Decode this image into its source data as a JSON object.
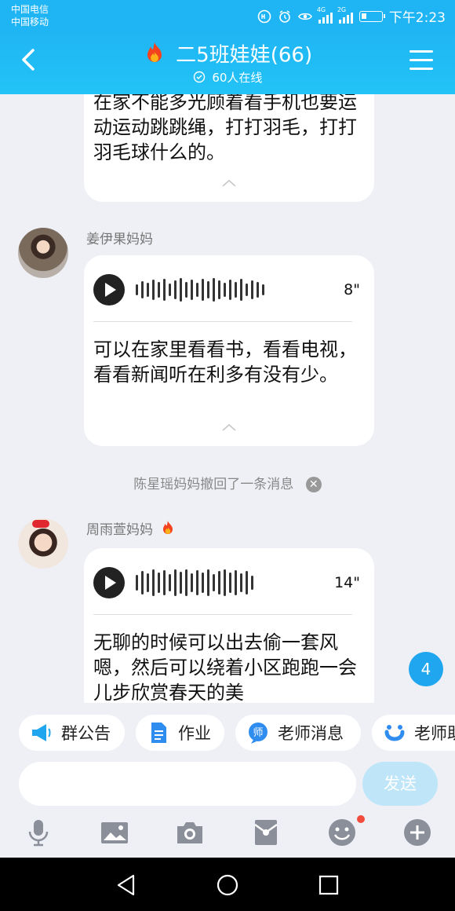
{
  "status_bar": {
    "carrier1": "中国电信",
    "carrier2": "中国移动",
    "time": "下午2:23",
    "net1": "4G",
    "net2": "2G"
  },
  "header": {
    "title": "二5班娃娃(66)",
    "online": "60人在线"
  },
  "messages": [
    {
      "text": "在家不能多光顾着看手机也要运动运动跳跳绳，打打羽毛，打打羽毛球什么的。"
    },
    {
      "sender": "姜伊果妈妈",
      "duration": "8\"",
      "text": "可以在家里看看书，看看电视，看看新闻听在利多有没有少。"
    },
    {
      "notice": "陈星瑶妈妈撤回了一条消息"
    },
    {
      "sender": "周雨萱妈妈",
      "duration": "14\"",
      "text": "无聊的时候可以出去偷一套风嗯，然后可以绕着小区跑跑一会儿步欣赏春天的美"
    }
  ],
  "unread_count": "4",
  "quick_actions": [
    {
      "label": "群公告",
      "icon": "megaphone-icon"
    },
    {
      "label": "作业",
      "icon": "document-icon"
    },
    {
      "label": "老师消息",
      "icon": "teacher-icon"
    },
    {
      "label": "老师助",
      "icon": "smile-u-icon"
    }
  ],
  "input": {
    "placeholder": "",
    "send_label": "发送"
  },
  "colors": {
    "brand": "#1fb5f4",
    "send_disabled": "#bfe6f8",
    "background": "#eef0f5"
  }
}
